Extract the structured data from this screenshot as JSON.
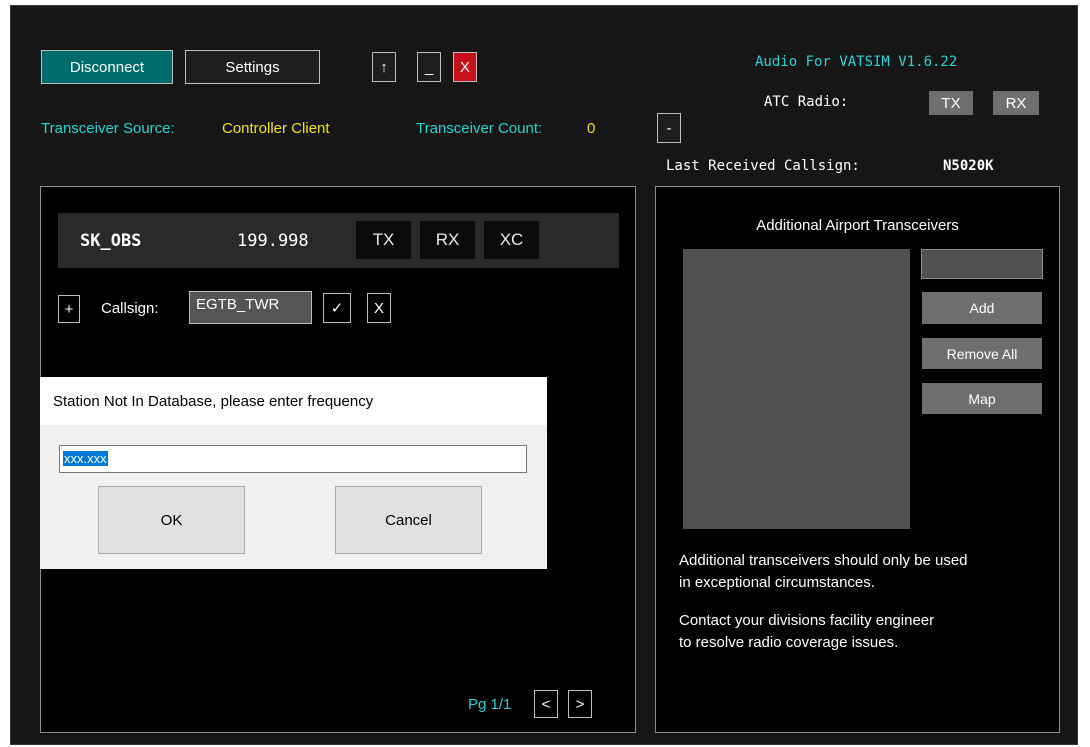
{
  "toolbar": {
    "disconnect_label": "Disconnect",
    "settings_label": "Settings",
    "up_label": "↑",
    "minimize_label": "_",
    "close_label": "X"
  },
  "header": {
    "app_title": "Audio For VATSIM V1.6.22",
    "atc_radio_label": "ATC Radio:",
    "atc_tx_label": "TX",
    "atc_rx_label": "RX",
    "source_label": "Transceiver Source:",
    "source_value": "Controller Client",
    "count_label": "Transceiver Count:",
    "count_value": "0",
    "collapse_label": "-",
    "last_received_label": "Last Received Callsign:",
    "last_received_value": "N5020K"
  },
  "station": {
    "callsign": "SK_OBS",
    "frequency": "199.998",
    "tx_label": "TX",
    "rx_label": "RX",
    "xc_label": "XC"
  },
  "callsign_row": {
    "add_label": "+",
    "label": "Callsign:",
    "value": "EGTB_TWR",
    "confirm_label": "✓",
    "cancel_label": "X"
  },
  "dialog": {
    "title": "Station Not In Database, please enter frequency",
    "input_value": "xxx.xxx",
    "ok_label": "OK",
    "cancel_label": "Cancel"
  },
  "pagination": {
    "page_label": "Pg 1/1",
    "prev_label": "<",
    "next_label": ">"
  },
  "airport": {
    "title": "Additional Airport Transceivers",
    "add_label": "Add",
    "remove_all_label": "Remove All",
    "map_label": "Map",
    "note1_line1": "Additional transceivers should only be used",
    "note1_line2": "in exceptional circumstances.",
    "note2_line1": "Contact your divisions facility engineer",
    "note2_line2": "to resolve radio coverage issues."
  },
  "colors": {
    "accent_cyan": "#22d4d4",
    "value_yellow": "#f2e500",
    "disconnect_teal": "#006b6b",
    "close_red": "#c8101b"
  }
}
